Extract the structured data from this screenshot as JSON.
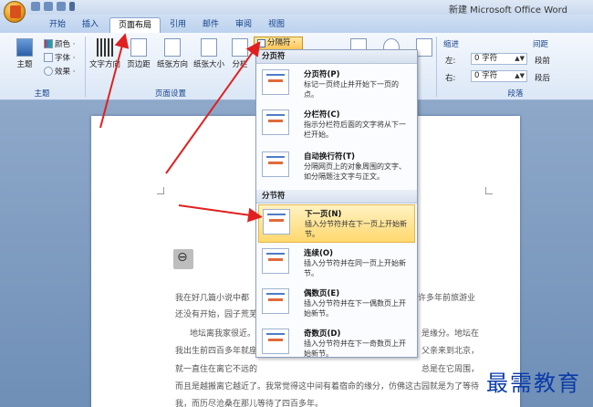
{
  "window": {
    "title": "新建 Microsoft Office Word"
  },
  "tabs": [
    {
      "label": "开始"
    },
    {
      "label": "插入"
    },
    {
      "label": "页面布局"
    },
    {
      "label": "引用"
    },
    {
      "label": "邮件"
    },
    {
      "label": "审阅"
    },
    {
      "label": "视图"
    }
  ],
  "ribbon": {
    "theme": {
      "label": "主题",
      "colors": "颜色 ·",
      "fonts": "字体 ·",
      "effects": "效果 ·",
      "group": "主题"
    },
    "page_setup": {
      "text_direction": "文字方向",
      "margins": "页边距",
      "orientation": "纸张方向",
      "size": "纸张大小",
      "columns": "分栏",
      "breaks": "分隔符 ·",
      "group": "页面设置"
    },
    "paragraph": {
      "indent_label": "缩进",
      "spacing_label": "间距",
      "left_label": "左:",
      "right_label": "右:",
      "left_value": "0 字符",
      "right_value": "0 字符",
      "before_label": "段前",
      "after_label": "段后",
      "group": "段落"
    }
  },
  "breaks_menu": {
    "page_breaks_header": "分页符",
    "section_breaks_header": "分节符",
    "items": [
      {
        "title": "分页符(P)",
        "desc": "标记一页终止并开始下一页的点。"
      },
      {
        "title": "分栏符(C)",
        "desc": "指示分栏符后面的文字将从下一栏开始。"
      },
      {
        "title": "自动换行符(T)",
        "desc": "分隔网页上的对象周围的文字、如分隔题注文字与正文。"
      },
      {
        "title": "下一页(N)",
        "desc": "插入分节符并在下一页上开始新节。"
      },
      {
        "title": "连续(O)",
        "desc": "插入分节符并在同一页上开始新节。"
      },
      {
        "title": "偶数页(E)",
        "desc": "插入分节符并在下一偶数页上开始新节。"
      },
      {
        "title": "奇数页(D)",
        "desc": "插入分节符并在下一奇数页上开始新节。"
      }
    ]
  },
  "document": {
    "lines": [
      "我在好几篇小说中都",
      "许多年前旅游业",
      "还没有开始，园子荒芜",
      "地坛离我家很近。或",
      "是缘分。地坛在",
      "我出生前四百多年就座",
      "父亲来到北京，",
      "就一直住在离它不远的",
      "总是在它周围，",
      "而且是越搬离它越近了。我常觉得这中间有着宿命的缘分，仿佛这古园就是为了等待",
      "我，而历尽沧桑在那儿等待了四百多年。"
    ]
  },
  "watermark": "最需教育",
  "colors": {
    "accent": "#ffc65a",
    "ribbon": "#dbe7f6",
    "workspace": "#7f9bc0",
    "arrow": "#e02020"
  }
}
